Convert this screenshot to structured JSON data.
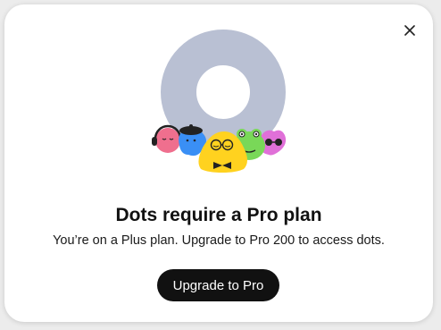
{
  "modal": {
    "title": "Dots require a Pro plan",
    "subtitle": "You’re on a Plus plan. Upgrade to Pro 200 to access dots.",
    "cta_label": "Upgrade to Pro",
    "close_icon": "close-icon",
    "illustration": "dots-characters-illustration"
  },
  "colors": {
    "ring": "#b9c0d3",
    "button_bg": "#111111",
    "button_text": "#ffffff",
    "pink_character": "#ef6f8e",
    "blue_character": "#3a8ff5",
    "yellow_character": "#ffd21f",
    "green_character": "#79d858",
    "magenta_character": "#e070d8"
  }
}
